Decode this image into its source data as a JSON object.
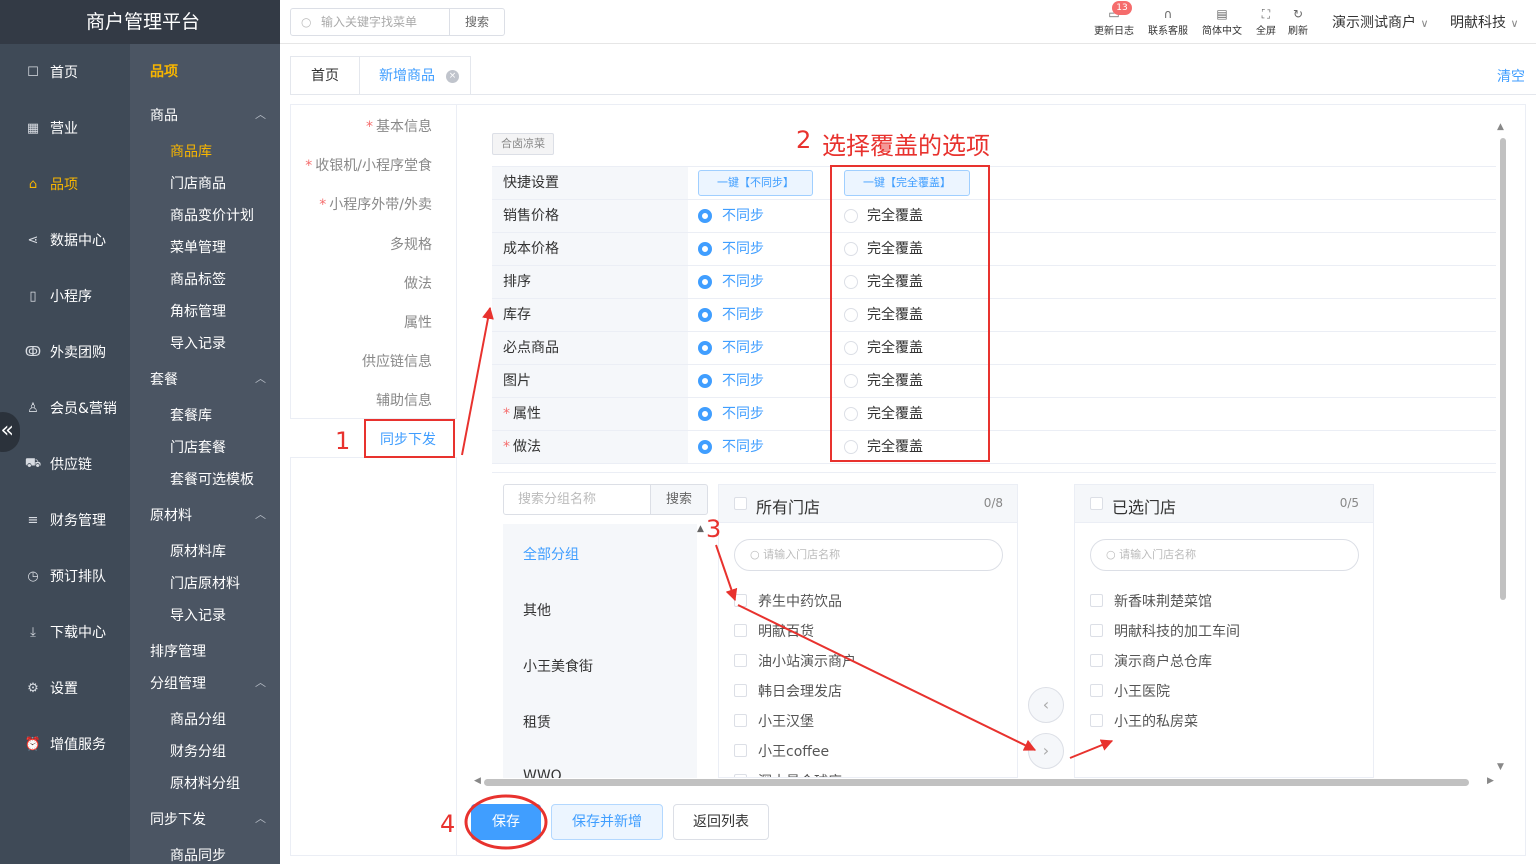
{
  "brand": "商户管理平台",
  "nav": [
    {
      "label": "首页",
      "icon": "home-icon",
      "active": false
    },
    {
      "label": "营业",
      "icon": "calendar-icon",
      "active": false
    },
    {
      "label": "品项",
      "icon": "bag-icon",
      "active": true
    },
    {
      "label": "数据中心",
      "icon": "share-icon",
      "active": false
    },
    {
      "label": "小程序",
      "icon": "phone-icon",
      "active": false
    },
    {
      "label": "外卖团购",
      "icon": "bike-icon",
      "active": false
    },
    {
      "label": "会员&营销",
      "icon": "user-icon",
      "active": false
    },
    {
      "label": "供应链",
      "icon": "truck-icon",
      "active": false
    },
    {
      "label": "财务管理",
      "icon": "database-icon",
      "active": false
    },
    {
      "label": "预订排队",
      "icon": "clock-icon",
      "active": false
    },
    {
      "label": "下载中心",
      "icon": "download-icon",
      "active": false
    },
    {
      "label": "设置",
      "icon": "gear-icon",
      "active": false
    },
    {
      "label": "增值服务",
      "icon": "alarm-icon",
      "active": false
    }
  ],
  "subnav": {
    "title": "品项",
    "groups": [
      {
        "label": "商品",
        "items": [
          "商品库",
          "门店商品",
          "商品变价计划",
          "菜单管理",
          "商品标签",
          "角标管理",
          "导入记录"
        ]
      },
      {
        "label": "套餐",
        "items": [
          "套餐库",
          "门店套餐",
          "套餐可选模板"
        ]
      },
      {
        "label": "原材料",
        "items": [
          "原材料库",
          "门店原材料",
          "导入记录"
        ]
      },
      {
        "label": "排序管理",
        "items": []
      },
      {
        "label": "分组管理",
        "items": [
          "商品分组",
          "财务分组",
          "原材料分组"
        ]
      },
      {
        "label": "同步下发",
        "items": [
          "商品同步"
        ]
      }
    ],
    "active_item": "商品库"
  },
  "topbar": {
    "search_placeholder": "输入关键字找菜单",
    "search_button": "搜索",
    "badge": "13",
    "tools": [
      "更新日志",
      "联系客服",
      "简体中文",
      "全屏",
      "刷新"
    ],
    "merchant": "演示测试商户",
    "company": "明献科技"
  },
  "tabs": {
    "home": "首页",
    "current": "新增商品",
    "close": "×",
    "clear": "清空"
  },
  "form_nav": [
    {
      "label": "基本信息",
      "required": true
    },
    {
      "label": "收银机/小程序堂食",
      "required": true
    },
    {
      "label": "小程序外带/外卖",
      "required": true
    },
    {
      "label": "多规格",
      "required": false
    },
    {
      "label": "做法",
      "required": false
    },
    {
      "label": "属性",
      "required": false
    },
    {
      "label": "供应链信息",
      "required": false
    },
    {
      "label": "辅助信息",
      "required": false
    },
    {
      "label": "同步下发",
      "required": false
    }
  ],
  "sync": {
    "tag": "合卤凉菜",
    "quick_label": "快捷设置",
    "quick_no_sync": "一键【不同步】",
    "quick_overwrite": "一键【完全覆盖】",
    "option_no_sync": "不同步",
    "option_overwrite": "完全覆盖",
    "rows": [
      {
        "label": "销售价格",
        "required": false,
        "selected": "no_sync"
      },
      {
        "label": "成本价格",
        "required": false,
        "selected": "no_sync"
      },
      {
        "label": "排序",
        "required": false,
        "selected": "no_sync"
      },
      {
        "label": "库存",
        "required": false,
        "selected": "no_sync"
      },
      {
        "label": "必点商品",
        "required": false,
        "selected": "no_sync"
      },
      {
        "label": "图片",
        "required": false,
        "selected": "no_sync"
      },
      {
        "label": "属性",
        "required": true,
        "selected": "no_sync"
      },
      {
        "label": "做法",
        "required": true,
        "selected": "no_sync"
      }
    ]
  },
  "stores": {
    "group_search_placeholder": "搜索分组名称",
    "group_search_button": "搜索",
    "groups": [
      "全部分组",
      "其他",
      "小王美食街",
      "租赁",
      "WWQ"
    ],
    "active_group": "全部分组",
    "all_title": "所有门店",
    "all_count": "0/8",
    "all_search_placeholder": "请输入门店名称",
    "all_items": [
      "养生中药饮品",
      "明献百货",
      "油小站演示商户",
      "韩日会理发店",
      "小王汉堡",
      "小王coffee",
      "深十量会球店"
    ],
    "selected_title": "已选门店",
    "selected_count": "0/5",
    "selected_search_placeholder": "请输入门店名称",
    "selected_items": [
      "新香味荆楚菜馆",
      "明献科技的加工车间",
      "演示商户总仓库",
      "小王医院",
      "小王的私房菜"
    ]
  },
  "buttons": {
    "save": "保存",
    "save_new": "保存并新增",
    "back": "返回列表"
  },
  "annotations": {
    "n1": "1",
    "n2": "2",
    "n2_text": "选择覆盖的选项",
    "n3": "3",
    "n4": "4",
    "color": "#e8322e"
  }
}
